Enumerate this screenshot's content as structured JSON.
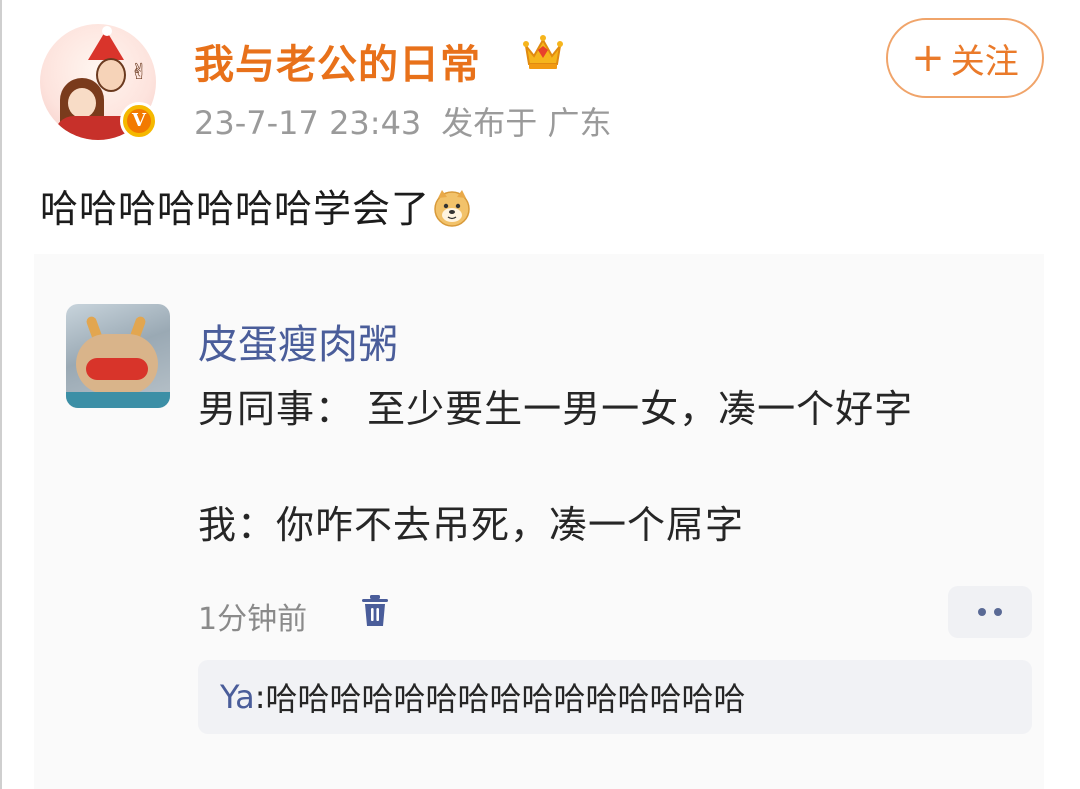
{
  "post": {
    "author": "我与老公的日常",
    "timestamp": "23-7-17 23:43",
    "location": "发布于 广东",
    "follow_label": "关注",
    "follow_plus": "+",
    "text": "哈哈哈哈哈哈哈学会了"
  },
  "comment": {
    "author": "皮蛋瘦肉粥",
    "line1": "男同事： 至少要生一男一女，凑一个好字",
    "line2": "我：你咋不去吊死，凑一个屌字",
    "time": "1分钟前",
    "reply": {
      "name": "Ya",
      "sep": ": ",
      "text": "哈哈哈哈哈哈哈哈哈哈哈哈哈哈哈"
    }
  },
  "icons": {
    "crown": "crown-icon",
    "verified": "verified-badge-icon",
    "doge": "doge-emoji-icon",
    "trash": "trash-icon",
    "more": "more-dots-icon"
  },
  "colors": {
    "author": "#e8711a",
    "follow": "#ea7a2a",
    "comment_author": "#4a5d9a",
    "meta": "#9a9a9a"
  }
}
